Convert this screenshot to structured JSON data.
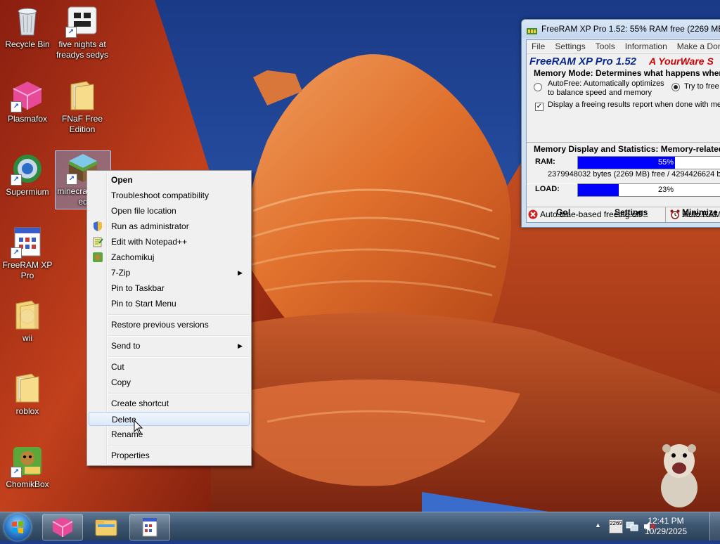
{
  "desktop": {
    "icons": [
      {
        "label": "Recycle Bin",
        "icon": "recycle-bin-icon"
      },
      {
        "label": "five nights at freadys sedys",
        "icon": "shortcut-icon"
      },
      {
        "label": "Plasmafox",
        "icon": "plasmafox-icon"
      },
      {
        "label": "FNaF Free Edition",
        "icon": "folder-icon"
      },
      {
        "label": "Supermium",
        "icon": "supermium-icon"
      },
      {
        "label": "minecraft free ed",
        "icon": "minecraft-icon"
      },
      {
        "label": "FreeRAM XP Pro",
        "icon": "freeram-icon"
      },
      {
        "label": "wii",
        "icon": "folder-icon"
      },
      {
        "label": "roblox",
        "icon": "folder-icon"
      },
      {
        "label": "ChomikBox",
        "icon": "chomikbox-icon"
      }
    ]
  },
  "context_menu": {
    "items": [
      {
        "label": "Open",
        "bold": true
      },
      {
        "label": "Troubleshoot compatibility"
      },
      {
        "label": "Open file location"
      },
      {
        "label": "Run as administrator",
        "icon": "shield-icon"
      },
      {
        "label": "Edit with Notepad++",
        "icon": "notepad-icon"
      },
      {
        "label": "Zachomikuj",
        "icon": "chomik-icon"
      },
      {
        "label": "7-Zip",
        "submenu": true
      },
      {
        "label": "Pin to Taskbar"
      },
      {
        "label": "Pin to Start Menu"
      },
      {
        "label": "Restore previous versions"
      },
      {
        "label": "Send to",
        "submenu": true
      },
      {
        "label": "Cut"
      },
      {
        "label": "Copy"
      },
      {
        "label": "Create shortcut"
      },
      {
        "label": "Delete",
        "highlighted": true
      },
      {
        "label": "Rename"
      },
      {
        "label": "Properties"
      }
    ]
  },
  "freeram": {
    "title": "FreeRAM XP Pro 1.52: 55% RAM free (2269 MB)",
    "menu": [
      "File",
      "Settings",
      "Tools",
      "Information",
      "Make a Don"
    ],
    "header_name": "FreeRAM XP Pro 1.52",
    "header_brand": "A YourWare S",
    "memory_mode_title": "Memory Mode: Determines what happens wher",
    "autofree_label": "AutoFree: Automatically optimizes to balance speed and memory",
    "tryfree_label": "Try to free",
    "display_report_label": "Display a freeing results report when done with mem",
    "stats_title": "Memory Display and Statistics: Memory-related",
    "ram_label": "RAM:",
    "ram_percent": 55,
    "ram_percent_text": "55%",
    "bytes_text": "2379948032 bytes (2269 MB) free / 4294426624 by",
    "load_label": "LOAD:",
    "load_percent": 23,
    "load_percent_text": "23%",
    "buttons": {
      "go": "Go!",
      "settings": "Settings",
      "minimize": "Minimize"
    },
    "status_left": "Auto time-based freeing off",
    "status_right": "Auto RAM"
  },
  "taskbar": {
    "time": "12:41 PM",
    "date": "10/29/2025",
    "tray_mem": "2269"
  },
  "colors": {
    "bar_fill": "#0000ff",
    "header_blue": "#0a2a8a",
    "header_red": "#d00000"
  }
}
